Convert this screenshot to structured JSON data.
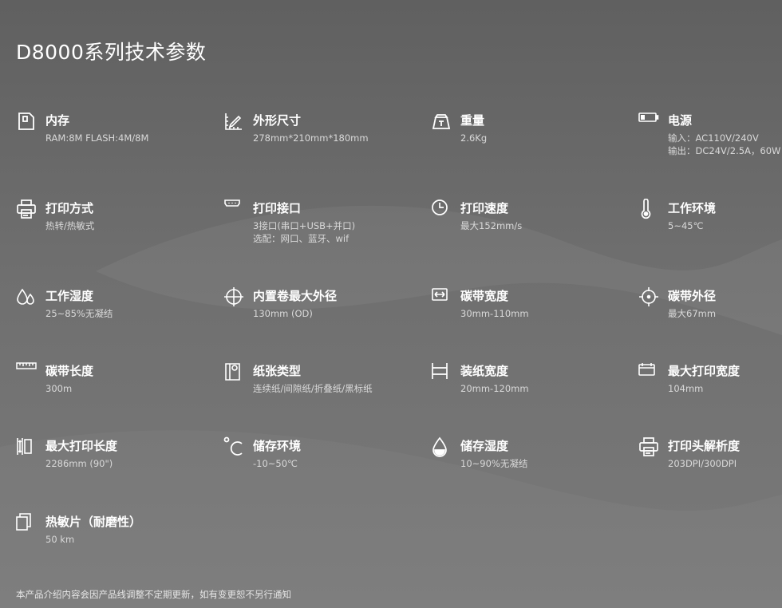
{
  "page_title": "D8000系列技术参数",
  "specs": [
    {
      "icon": "memory-card-icon",
      "name": "内存",
      "value": "RAM:8M FLASH:4M/8M",
      "value2": ""
    },
    {
      "icon": "ruler-pencil-icon",
      "name": "外形尺寸",
      "value": "278mm*210mm*180mm",
      "value2": ""
    },
    {
      "icon": "weight-icon",
      "name": "重量",
      "value": "2.6Kg",
      "value2": ""
    },
    {
      "icon": "battery-icon",
      "name": "电源",
      "value": "输入：AC110V/240V",
      "value2": "输出：DC24V/2.5A，60W"
    },
    {
      "icon": "printer-icon",
      "name": "打印方式",
      "value": "热转/热敏式",
      "value2": ""
    },
    {
      "icon": "port-icon",
      "name": "打印接口",
      "value": "3接口(串口+USB+并口)",
      "value2": "选配：网口、蓝牙、wif"
    },
    {
      "icon": "clock-icon",
      "name": "打印速度",
      "value": "最大152mm/s",
      "value2": ""
    },
    {
      "icon": "thermometer-icon",
      "name": "工作环境",
      "value": "5~45℃",
      "value2": ""
    },
    {
      "icon": "water-drops-icon",
      "name": "工作湿度",
      "value": "25~85%无凝结",
      "value2": ""
    },
    {
      "icon": "crosshair-icon",
      "name": "内置卷最大外径",
      "value": "130mm (OD)",
      "value2": ""
    },
    {
      "icon": "width-arrows-icon",
      "name": "碳带宽度",
      "value": "30mm-110mm",
      "value2": ""
    },
    {
      "icon": "target-icon",
      "name": "碳带外径",
      "value": "最大67mm",
      "value2": ""
    },
    {
      "icon": "ruler-icon",
      "name": "碳带长度",
      "value": "300m",
      "value2": ""
    },
    {
      "icon": "paper-roll-icon",
      "name": "纸张类型",
      "value": "连续纸/间隙纸/折叠纸/黑标纸",
      "value2": ""
    },
    {
      "icon": "paper-width-icon",
      "name": "装纸宽度",
      "value": "20mm-120mm",
      "value2": ""
    },
    {
      "icon": "print-width-icon",
      "name": "最大打印宽度",
      "value": "104mm",
      "value2": ""
    },
    {
      "icon": "print-length-icon",
      "name": "最大打印长度",
      "value": "2286mm (90\")",
      "value2": ""
    },
    {
      "icon": "celsius-icon",
      "name": "储存环境",
      "value": "-10~50℃",
      "value2": ""
    },
    {
      "icon": "humidity-drop-icon",
      "name": "储存湿度",
      "value": "10~90%无凝结",
      "value2": ""
    },
    {
      "icon": "printer-head-icon",
      "name": "打印头解析度",
      "value": "203DPI/300DPI",
      "value2": ""
    },
    {
      "icon": "copy-pages-icon",
      "name": "热敏片（耐磨性）",
      "value": "50 km",
      "value2": ""
    }
  ],
  "footer_note": "本产品介绍内容会因产品线调整不定期更新，如有变更恕不另行通知"
}
